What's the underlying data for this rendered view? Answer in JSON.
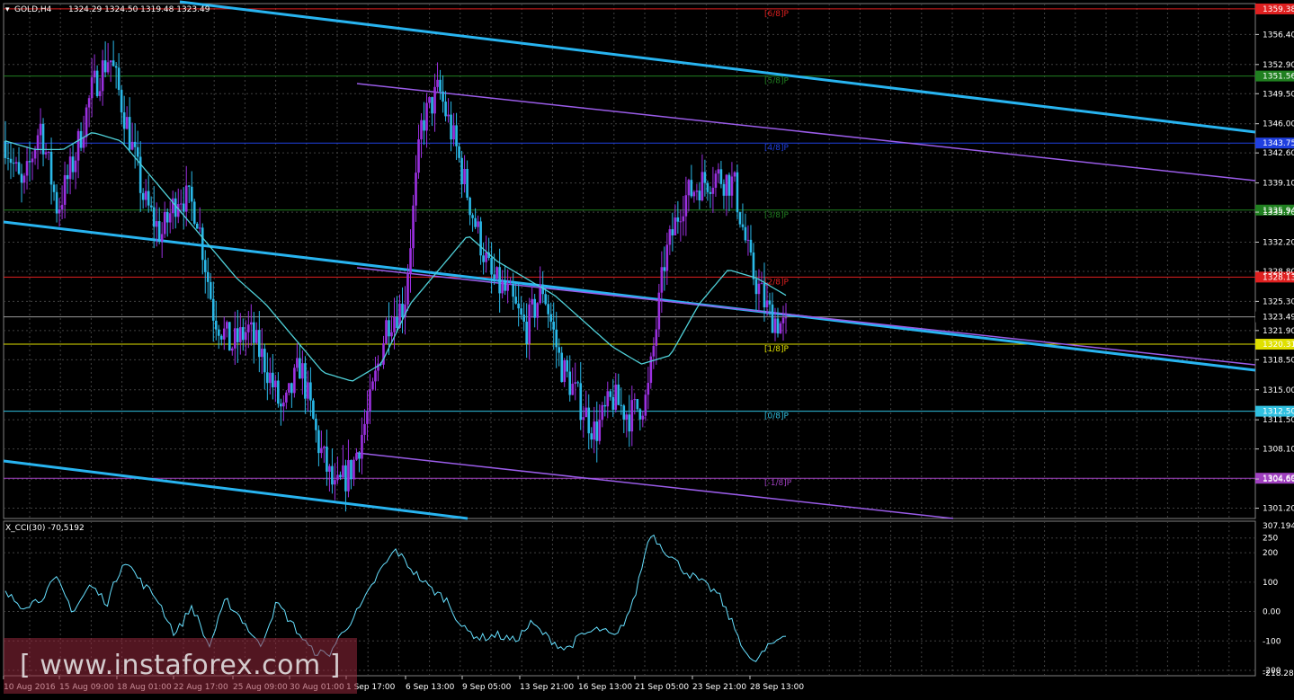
{
  "header": {
    "symbol": "GOLD,H4",
    "ohlc": "1324.29 1324.50 1319.48 1323.49"
  },
  "indicator": {
    "label": "X_CCI(30) -70,5192",
    "axis_ticks": [
      "307.194",
      "250",
      "200",
      "100",
      "0.00",
      "-100",
      "-200",
      "-218.282"
    ]
  },
  "watermark": {
    "text": "[ www.instaforex.com ]"
  },
  "colors": {
    "bull": "#9b30e0",
    "bear": "#2ab8e8",
    "ma": "#4fd0d8",
    "channel": "#28b4f0",
    "channel_inner": "#9a5ce8",
    "grid": "#404040",
    "cci": "#66e0ff"
  },
  "chart_data": {
    "type": "candlestick",
    "price_axis": {
      "ylim": [
        1300.0,
        1360.0
      ],
      "ticks": [
        "1356.40",
        "1352.90",
        "1349.50",
        "1346.00",
        "1342.60",
        "1339.10",
        "1335.70",
        "1332.20",
        "1328.80",
        "1325.30",
        "1321.90",
        "1318.50",
        "1315.00",
        "1311.50",
        "1308.10",
        "1304.60",
        "1301.20"
      ],
      "current_price": "1323.49"
    },
    "x_labels": [
      "10 Aug 2016",
      "15 Aug 09:00",
      "18 Aug 01:00",
      "22 Aug 17:00",
      "25 Aug 09:00",
      "30 Aug 01:00",
      "1 Sep 17:00",
      "6 Sep 13:00",
      "9 Sep 05:00",
      "13 Sep 21:00",
      "16 Sep 13:00",
      "21 Sep 05:00",
      "23 Sep 21:00",
      "28 Sep 13:00"
    ],
    "murrey_levels": [
      {
        "label": "[6/8]P",
        "price": "1359.38",
        "color": "#e02020"
      },
      {
        "label": "[5/8]P",
        "price": "1351.56",
        "color": "#208020"
      },
      {
        "label": "[4/8]P",
        "price": "1343.75",
        "color": "#2040e0"
      },
      {
        "label": "[3/8]P",
        "price": "1335.94",
        "color": "#208020"
      },
      {
        "label": "[2/8]P",
        "price": "1328.13",
        "color": "#e02020"
      },
      {
        "label": "[1/8]P",
        "price": "1320.31",
        "color": "#e0e000"
      },
      {
        "label": "[0/8]P",
        "price": "1312.50",
        "color": "#30c0e0"
      },
      {
        "label": "[-1/8]P",
        "price": "1304.69",
        "color": "#a040c0"
      }
    ],
    "price_path": [
      1344,
      1338,
      1346,
      1336,
      1342,
      1350,
      1354,
      1346,
      1337,
      1333,
      1338,
      1336,
      1324,
      1320,
      1322,
      1318,
      1312,
      1318,
      1309,
      1303,
      1306,
      1313,
      1323,
      1325,
      1346,
      1350,
      1343,
      1335,
      1328,
      1326,
      1322,
      1327,
      1318,
      1314,
      1310,
      1314,
      1312,
      1314,
      1330,
      1337,
      1339,
      1340,
      1339,
      1329,
      1324,
      1322
    ],
    "ma_path": [
      1344,
      1343,
      1343,
      1345,
      1344,
      1340,
      1336,
      1332,
      1328,
      1325,
      1321,
      1317,
      1316,
      1318,
      1325,
      1329,
      1333,
      1330,
      1328,
      1326,
      1323,
      1320,
      1318,
      1319,
      1325,
      1329,
      1328,
      1326
    ],
    "cci_path": [
      60,
      20,
      40,
      110,
      0,
      90,
      30,
      180,
      100,
      40,
      -80,
      20,
      -120,
      40,
      -30,
      -120,
      30,
      -50,
      -130,
      -150,
      -60,
      20,
      130,
      210,
      140,
      80,
      40,
      -60,
      -90,
      -80,
      -100,
      -40,
      -90,
      -130,
      -80,
      -60,
      -90,
      30,
      270,
      200,
      140,
      100,
      60,
      -60,
      -180,
      -120,
      -70
    ]
  }
}
